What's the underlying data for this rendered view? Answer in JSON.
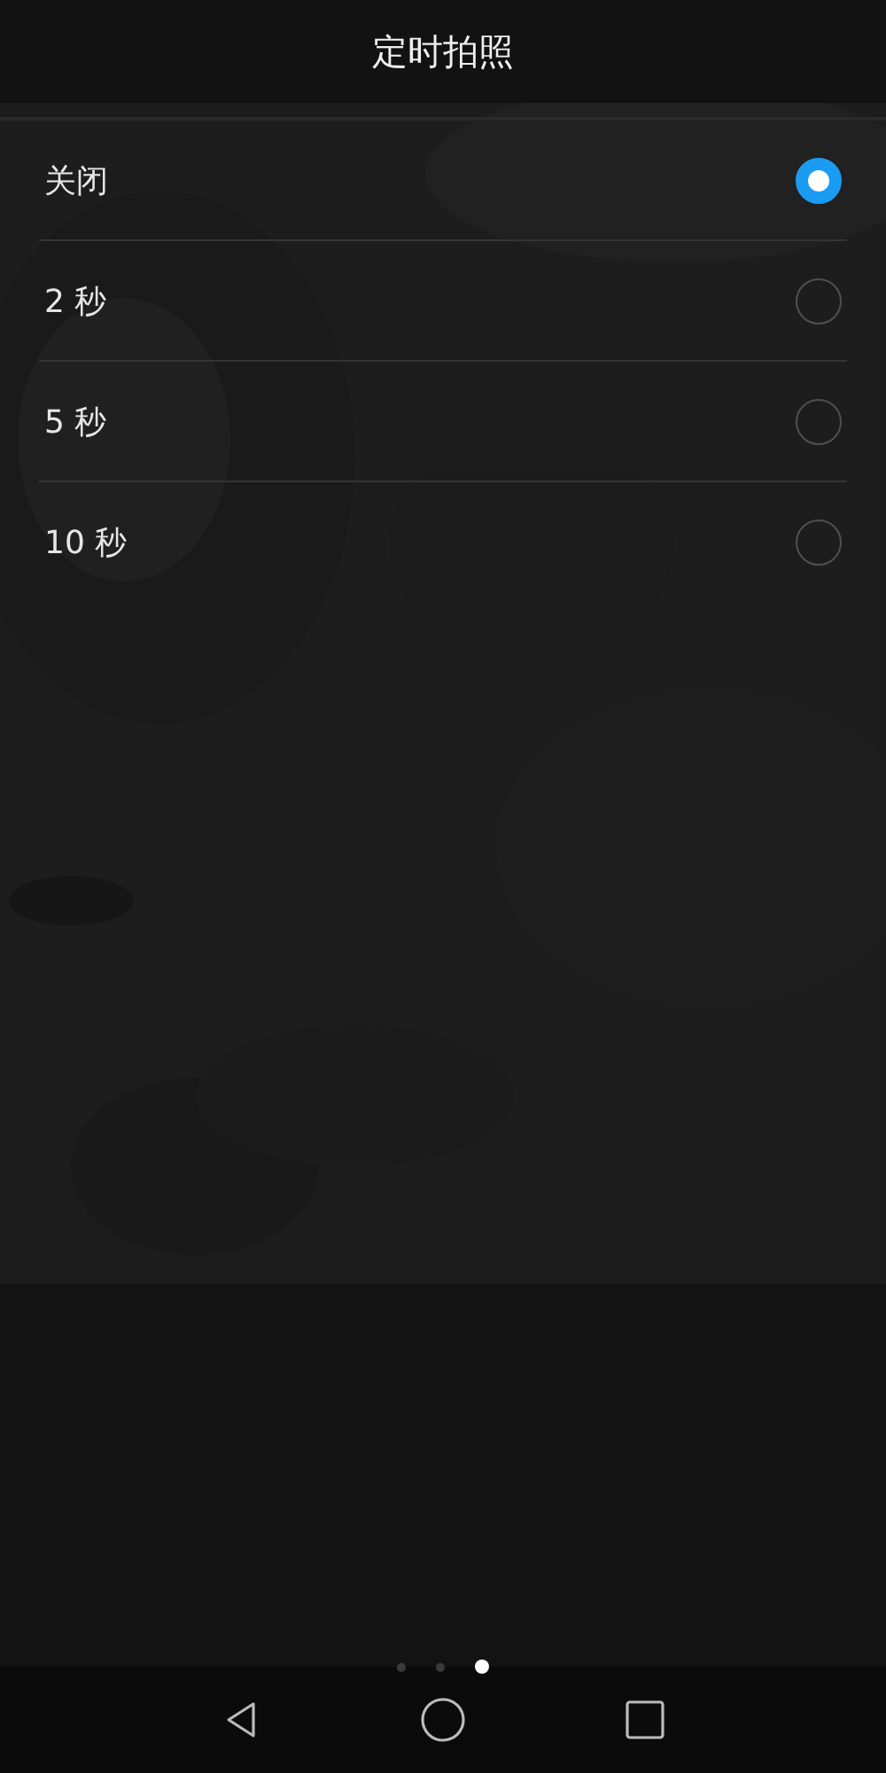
{
  "title": "定时拍照",
  "options": [
    {
      "label": "关闭",
      "selected": true
    },
    {
      "label": "2 秒",
      "selected": false
    },
    {
      "label": "5 秒",
      "selected": false
    },
    {
      "label": "10 秒",
      "selected": false
    }
  ],
  "page_dots": [
    {
      "selected": false
    },
    {
      "selected": false
    },
    {
      "selected": true
    }
  ]
}
